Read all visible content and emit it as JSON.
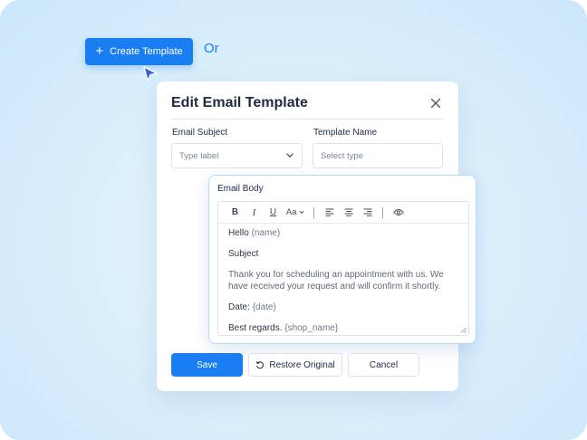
{
  "top": {
    "create_button_label": "Create Template",
    "or_text": "Or"
  },
  "modal": {
    "title": "Edit Email Template",
    "email_subject": {
      "label": "Email Subject",
      "value": "Type label"
    },
    "template_name": {
      "label": "Template Name",
      "placeholder": "Select type"
    }
  },
  "email_body": {
    "label": "Email Body",
    "toolbar": {
      "bold": "B",
      "italic": "I",
      "underline": "U",
      "font_size": "Aa"
    },
    "lines": {
      "greeting": "Hello",
      "greeting_var": "(name)",
      "subject": "Subject",
      "message": "Thank you for scheduling an appointment with us. We have received your request and will confirm it shortly.",
      "date_label": "Date:",
      "date_var": "{date}",
      "closing": "Best regards.",
      "closing_var": "{shop_name}"
    }
  },
  "actions": {
    "save_label": "Save",
    "restore_label": "Restore Original",
    "cancel_label": "Cancel"
  },
  "colors": {
    "accent": "#1a7ef2",
    "background": "#d9eefb"
  }
}
